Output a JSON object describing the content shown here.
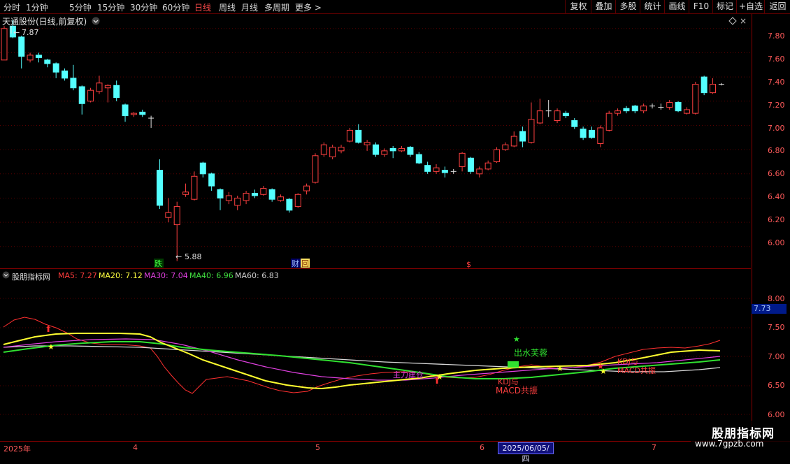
{
  "toolbar": {
    "periods": [
      "分时",
      "1分钟",
      "5分钟",
      "15分钟",
      "30分钟",
      "60分钟",
      "日线",
      "周线",
      "月线",
      "多周期",
      "更多 >"
    ],
    "active_period": "日线",
    "actions": [
      "复权",
      "叠加",
      "多股",
      "统计",
      "画线",
      "F10",
      "标记",
      "+自选",
      "返回"
    ]
  },
  "main_chart": {
    "title": "天通股份(日线,前复权)",
    "high_marker": "7.87",
    "low_marker": "5.88",
    "event_badges": [
      "跌",
      "财",
      "回",
      "$"
    ],
    "price_ticks": [
      "7.80",
      "7.60",
      "7.40",
      "7.20",
      "7.00",
      "6.80",
      "6.60",
      "6.40",
      "6.20",
      "6.00"
    ]
  },
  "indicator": {
    "name": "股朋指标网",
    "ma": [
      {
        "label": "MA5:",
        "value": "7.27",
        "color": "#ff3c3c"
      },
      {
        "label": "MA20:",
        "value": "7.12",
        "color": "#ffff40"
      },
      {
        "label": "MA30:",
        "value": "7.04",
        "color": "#e040e0"
      },
      {
        "label": "MA40:",
        "value": "6.96",
        "color": "#40e040"
      },
      {
        "label": "MA60:",
        "value": "6.83",
        "color": "#d0d0d0"
      }
    ],
    "ticks": [
      "8.00",
      "7.50",
      "7.00",
      "6.50",
      "6.00"
    ],
    "current_value": "7.73",
    "signals": [
      "出水芙蓉",
      "KDJ与",
      "MACD共振",
      "主力建仓"
    ]
  },
  "date_axis": {
    "labels": [
      "2025年",
      "4",
      "5",
      "6",
      "7"
    ],
    "cursor_date": "2025/06/05/四"
  },
  "watermark": {
    "brand": "股朋指标网",
    "url": "www.7gpzb.com"
  },
  "colors": {
    "up": "#ff4040",
    "down": "#54ffff",
    "grid": "#5a0000",
    "axis": "#ff5a5a"
  },
  "chart_data": {
    "type": "candlestick",
    "title": "天通股份(日线,前复权)",
    "ylim": [
      5.82,
      7.92
    ],
    "candles": [
      {
        "o": 7.54,
        "c": 7.8,
        "h": 7.82,
        "l": 7.54
      },
      {
        "o": 7.82,
        "c": 7.73,
        "h": 7.87,
        "l": 7.72
      },
      {
        "o": 7.73,
        "c": 7.57,
        "h": 7.74,
        "l": 7.47
      },
      {
        "o": 7.54,
        "c": 7.58,
        "h": 7.6,
        "l": 7.52
      },
      {
        "o": 7.58,
        "c": 7.56,
        "h": 7.6,
        "l": 7.52
      },
      {
        "o": 7.54,
        "c": 7.51,
        "h": 7.55,
        "l": 7.48
      },
      {
        "o": 7.51,
        "c": 7.44,
        "h": 7.52,
        "l": 7.39
      },
      {
        "o": 7.45,
        "c": 7.39,
        "h": 7.47,
        "l": 7.37
      },
      {
        "o": 7.39,
        "c": 7.31,
        "h": 7.5,
        "l": 7.29
      },
      {
        "o": 7.32,
        "c": 7.18,
        "h": 7.33,
        "l": 7.09
      },
      {
        "o": 7.2,
        "c": 7.29,
        "h": 7.31,
        "l": 7.19
      },
      {
        "o": 7.28,
        "c": 7.35,
        "h": 7.41,
        "l": 7.26
      },
      {
        "o": 7.31,
        "c": 7.33,
        "h": 7.34,
        "l": 7.19
      },
      {
        "o": 7.33,
        "c": 7.23,
        "h": 7.37,
        "l": 7.2
      },
      {
        "o": 7.17,
        "c": 7.08,
        "h": 7.18,
        "l": 7.03
      },
      {
        "o": 7.09,
        "c": 7.1,
        "h": 7.11,
        "l": 7.07
      },
      {
        "o": 7.11,
        "c": 7.09,
        "h": 7.13,
        "l": 7.07
      },
      {
        "o": 7.06,
        "c": 7.06,
        "h": 7.08,
        "l": 6.98
      },
      {
        "o": 6.63,
        "c": 6.34,
        "h": 6.72,
        "l": 6.31
      },
      {
        "o": 6.24,
        "c": 6.28,
        "h": 6.4,
        "l": 6.2
      },
      {
        "o": 6.18,
        "c": 6.33,
        "h": 6.37,
        "l": 5.88
      },
      {
        "o": 6.43,
        "c": 6.45,
        "h": 6.52,
        "l": 6.41
      },
      {
        "o": 6.39,
        "c": 6.58,
        "h": 6.62,
        "l": 6.38
      },
      {
        "o": 6.69,
        "c": 6.6,
        "h": 6.7,
        "l": 6.57
      },
      {
        "o": 6.6,
        "c": 6.5,
        "h": 6.61,
        "l": 6.46
      },
      {
        "o": 6.47,
        "c": 6.4,
        "h": 6.48,
        "l": 6.3
      },
      {
        "o": 6.38,
        "c": 6.42,
        "h": 6.45,
        "l": 6.35
      },
      {
        "o": 6.34,
        "c": 6.4,
        "h": 6.42,
        "l": 6.3
      },
      {
        "o": 6.38,
        "c": 6.44,
        "h": 6.46,
        "l": 6.35
      },
      {
        "o": 6.44,
        "c": 6.42,
        "h": 6.47,
        "l": 6.4
      },
      {
        "o": 6.43,
        "c": 6.48,
        "h": 6.5,
        "l": 6.42
      },
      {
        "o": 6.47,
        "c": 6.39,
        "h": 6.48,
        "l": 6.37
      },
      {
        "o": 6.38,
        "c": 6.41,
        "h": 6.43,
        "l": 6.37
      },
      {
        "o": 6.39,
        "c": 6.3,
        "h": 6.4,
        "l": 6.28
      },
      {
        "o": 6.33,
        "c": 6.43,
        "h": 6.44,
        "l": 6.32
      },
      {
        "o": 6.46,
        "c": 6.5,
        "h": 6.52,
        "l": 6.43
      },
      {
        "o": 6.53,
        "c": 6.75,
        "h": 6.77,
        "l": 6.52
      },
      {
        "o": 6.76,
        "c": 6.84,
        "h": 6.86,
        "l": 6.74
      },
      {
        "o": 6.74,
        "c": 6.82,
        "h": 6.84,
        "l": 6.72
      },
      {
        "o": 6.79,
        "c": 6.82,
        "h": 6.84,
        "l": 6.77
      },
      {
        "o": 6.87,
        "c": 6.96,
        "h": 6.98,
        "l": 6.86
      },
      {
        "o": 6.96,
        "c": 6.86,
        "h": 7.01,
        "l": 6.85
      },
      {
        "o": 6.84,
        "c": 6.86,
        "h": 6.88,
        "l": 6.79
      },
      {
        "o": 6.84,
        "c": 6.76,
        "h": 6.86,
        "l": 6.74
      },
      {
        "o": 6.76,
        "c": 6.79,
        "h": 6.81,
        "l": 6.74
      },
      {
        "o": 6.81,
        "c": 6.79,
        "h": 6.83,
        "l": 6.73
      },
      {
        "o": 6.79,
        "c": 6.81,
        "h": 6.83,
        "l": 6.78
      },
      {
        "o": 6.82,
        "c": 6.76,
        "h": 6.83,
        "l": 6.74
      },
      {
        "o": 6.76,
        "c": 6.69,
        "h": 6.78,
        "l": 6.68
      },
      {
        "o": 6.67,
        "c": 6.62,
        "h": 6.7,
        "l": 6.6
      },
      {
        "o": 6.62,
        "c": 6.65,
        "h": 6.68,
        "l": 6.6
      },
      {
        "o": 6.63,
        "c": 6.61,
        "h": 6.66,
        "l": 6.57
      },
      {
        "o": 6.62,
        "c": 6.62,
        "h": 6.64,
        "l": 6.6
      },
      {
        "o": 6.66,
        "c": 6.77,
        "h": 6.78,
        "l": 6.62
      },
      {
        "o": 6.73,
        "c": 6.62,
        "h": 6.74,
        "l": 6.6
      },
      {
        "o": 6.6,
        "c": 6.64,
        "h": 6.66,
        "l": 6.57
      },
      {
        "o": 6.64,
        "c": 6.69,
        "h": 6.71,
        "l": 6.63
      },
      {
        "o": 6.7,
        "c": 6.8,
        "h": 6.82,
        "l": 6.69
      },
      {
        "o": 6.8,
        "c": 6.84,
        "h": 6.86,
        "l": 6.79
      },
      {
        "o": 6.83,
        "c": 6.91,
        "h": 6.95,
        "l": 6.82
      },
      {
        "o": 6.95,
        "c": 6.87,
        "h": 6.99,
        "l": 6.82
      },
      {
        "o": 6.86,
        "c": 7.05,
        "h": 7.19,
        "l": 6.85
      },
      {
        "o": 7.02,
        "c": 7.12,
        "h": 7.22,
        "l": 7.01
      },
      {
        "o": 7.12,
        "c": 7.12,
        "h": 7.21,
        "l": 7.07
      },
      {
        "o": 7.04,
        "c": 7.12,
        "h": 7.14,
        "l": 7.02
      },
      {
        "o": 7.1,
        "c": 7.08,
        "h": 7.12,
        "l": 7.06
      },
      {
        "o": 7.04,
        "c": 6.99,
        "h": 7.06,
        "l": 6.97
      },
      {
        "o": 6.97,
        "c": 6.9,
        "h": 6.99,
        "l": 6.88
      },
      {
        "o": 6.96,
        "c": 6.9,
        "h": 6.99,
        "l": 6.89
      },
      {
        "o": 6.85,
        "c": 6.98,
        "h": 7.0,
        "l": 6.82
      },
      {
        "o": 6.96,
        "c": 7.1,
        "h": 7.12,
        "l": 6.95
      },
      {
        "o": 7.1,
        "c": 7.12,
        "h": 7.14,
        "l": 7.08
      },
      {
        "o": 7.14,
        "c": 7.12,
        "h": 7.16,
        "l": 7.1
      },
      {
        "o": 7.16,
        "c": 7.12,
        "h": 7.17,
        "l": 7.1
      },
      {
        "o": 7.12,
        "c": 7.16,
        "h": 7.18,
        "l": 7.1
      },
      {
        "o": 7.16,
        "c": 7.16,
        "h": 7.18,
        "l": 7.14
      },
      {
        "o": 7.15,
        "c": 7.15,
        "h": 7.18,
        "l": 7.13
      },
      {
        "o": 7.15,
        "c": 7.19,
        "h": 7.21,
        "l": 7.13
      },
      {
        "o": 7.19,
        "c": 7.12,
        "h": 7.2,
        "l": 7.11
      },
      {
        "o": 7.1,
        "c": 7.13,
        "h": 7.15,
        "l": 7.09
      },
      {
        "o": 7.1,
        "c": 7.34,
        "h": 7.36,
        "l": 7.09
      },
      {
        "o": 7.4,
        "c": 7.27,
        "h": 7.41,
        "l": 7.25
      },
      {
        "o": 7.27,
        "c": 7.34,
        "h": 7.39,
        "l": 7.26
      },
      {
        "o": 7.34,
        "c": 7.34,
        "h": 7.35,
        "l": 7.33
      }
    ]
  }
}
